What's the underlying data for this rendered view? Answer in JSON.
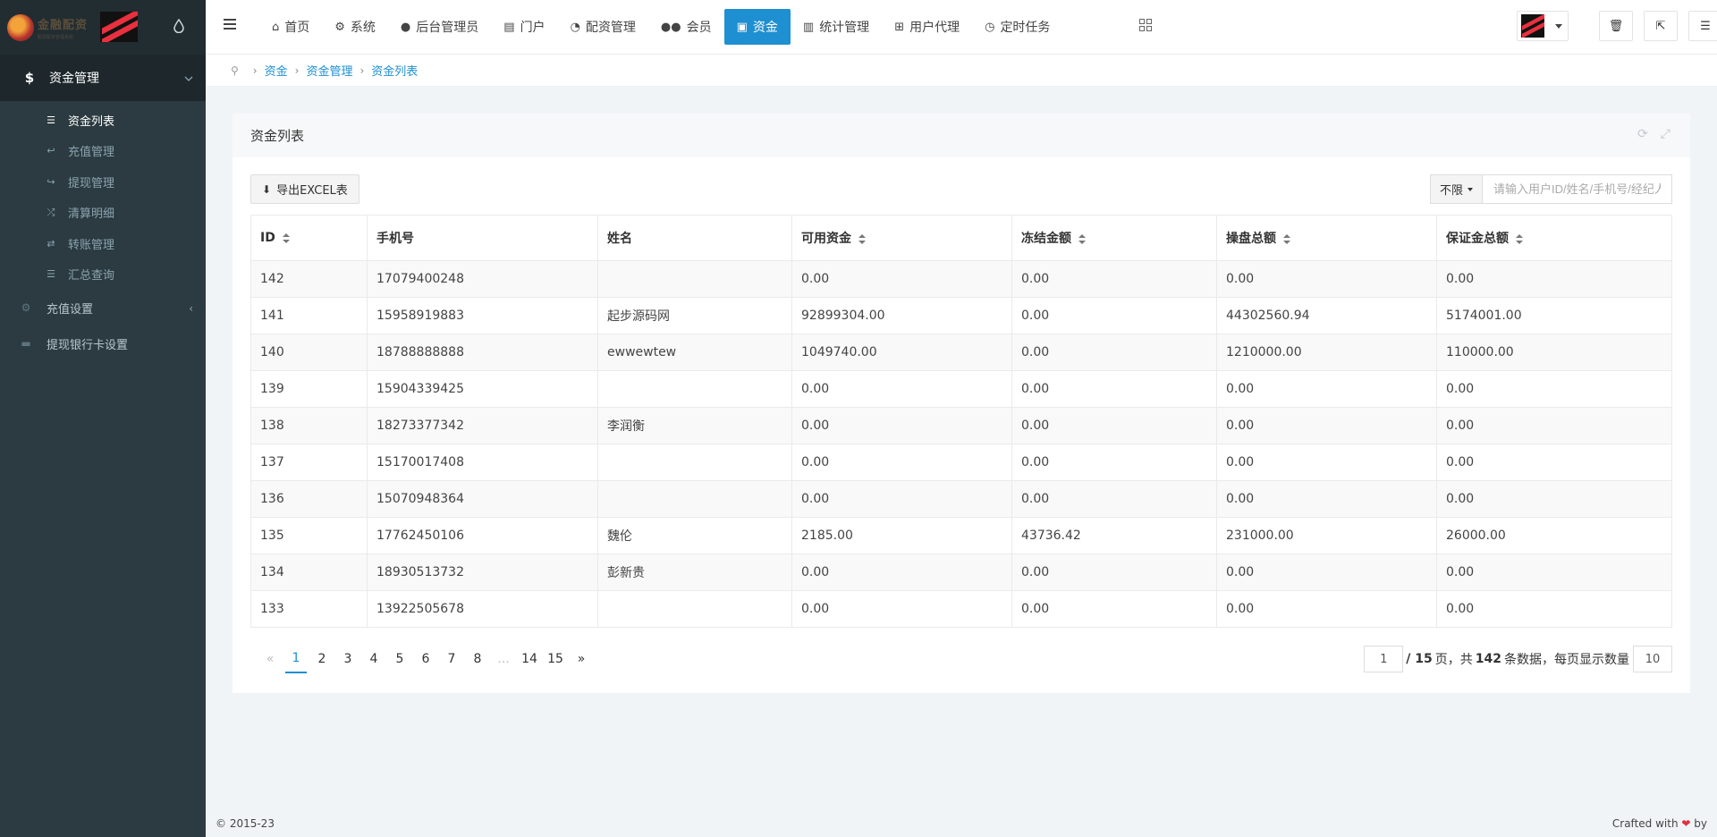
{
  "logo": {
    "title": "金融配资",
    "subtitle": "股票配资管理系统"
  },
  "sidebar": {
    "main": {
      "label": "资金管理",
      "icon": "dollar-icon"
    },
    "subitems": [
      {
        "label": "资金列表",
        "icon": "list-icon"
      },
      {
        "label": "充值管理",
        "icon": "reply-icon"
      },
      {
        "label": "提现管理",
        "icon": "share-icon"
      },
      {
        "label": "清算明细",
        "icon": "random-icon"
      },
      {
        "label": "转账管理",
        "icon": "exchange-icon"
      },
      {
        "label": "汇总查询",
        "icon": "list-icon"
      }
    ],
    "items": [
      {
        "label": "充值设置",
        "icon": "gear-icon"
      },
      {
        "label": "提现银行卡设置",
        "icon": "card-icon"
      }
    ]
  },
  "topnav": {
    "tabs": [
      {
        "label": "首页",
        "icon": "home-icon"
      },
      {
        "label": "系统",
        "icon": "gear-icon"
      },
      {
        "label": "后台管理员",
        "icon": "user-icon"
      },
      {
        "label": "门户",
        "icon": "newspaper-icon"
      },
      {
        "label": "配资管理",
        "icon": "pie-chart-icon"
      },
      {
        "label": "会员",
        "icon": "users-icon"
      },
      {
        "label": "资金",
        "icon": "money-icon"
      },
      {
        "label": "统计管理",
        "icon": "bar-chart-icon"
      },
      {
        "label": "用户代理",
        "icon": "sitemap-icon"
      },
      {
        "label": "定时任务",
        "icon": "clock-icon"
      }
    ],
    "active_tab": "资金"
  },
  "breadcrumb": [
    "资金",
    "资金管理",
    "资金列表"
  ],
  "panel": {
    "title": "资金列表",
    "export_label": "导出EXCEL表",
    "search_select": "不限",
    "search_placeholder": "请输入用户ID/姓名/手机号/经纪人"
  },
  "table": {
    "columns": [
      "ID",
      "手机号",
      "姓名",
      "可用资金",
      "冻结金额",
      "操盘总额",
      "保证金总额"
    ],
    "rows": [
      [
        "142",
        "17079400248",
        "",
        "0.00",
        "0.00",
        "0.00",
        "0.00"
      ],
      [
        "141",
        "15958919883",
        "起步源码网",
        "92899304.00",
        "0.00",
        "44302560.94",
        "5174001.00"
      ],
      [
        "140",
        "18788888888",
        "ewwewtew",
        "1049740.00",
        "0.00",
        "1210000.00",
        "110000.00"
      ],
      [
        "139",
        "15904339425",
        "",
        "0.00",
        "0.00",
        "0.00",
        "0.00"
      ],
      [
        "138",
        "18273377342",
        "李润衡",
        "0.00",
        "0.00",
        "0.00",
        "0.00"
      ],
      [
        "137",
        "15170017408",
        "",
        "0.00",
        "0.00",
        "0.00",
        "0.00"
      ],
      [
        "136",
        "15070948364",
        "",
        "0.00",
        "0.00",
        "0.00",
        "0.00"
      ],
      [
        "135",
        "17762450106",
        "魏伦",
        "2185.00",
        "43736.42",
        "231000.00",
        "26000.00"
      ],
      [
        "134",
        "18930513732",
        "彭新贵",
        "0.00",
        "0.00",
        "0.00",
        "0.00"
      ],
      [
        "133",
        "13922505678",
        "",
        "0.00",
        "0.00",
        "0.00",
        "0.00"
      ]
    ]
  },
  "pagination": {
    "prev": "«",
    "pages": [
      "1",
      "2",
      "3",
      "4",
      "5",
      "6",
      "7",
      "8",
      "...",
      "14",
      "15"
    ],
    "next": "»",
    "current": "1",
    "jump_value": "1",
    "total_pages_text": "/ 15",
    "page_unit": "页，共",
    "total_records": "142",
    "records_unit": "条数据，每页显示数量",
    "page_size": "10"
  },
  "footer": {
    "copyright": "© 2015-23",
    "crafted": "Crafted with",
    "by": "by"
  },
  "colors": {
    "accent": "#1e8fd0",
    "sidebar_bg": "#2c3b41",
    "heart": "#e0303e"
  }
}
